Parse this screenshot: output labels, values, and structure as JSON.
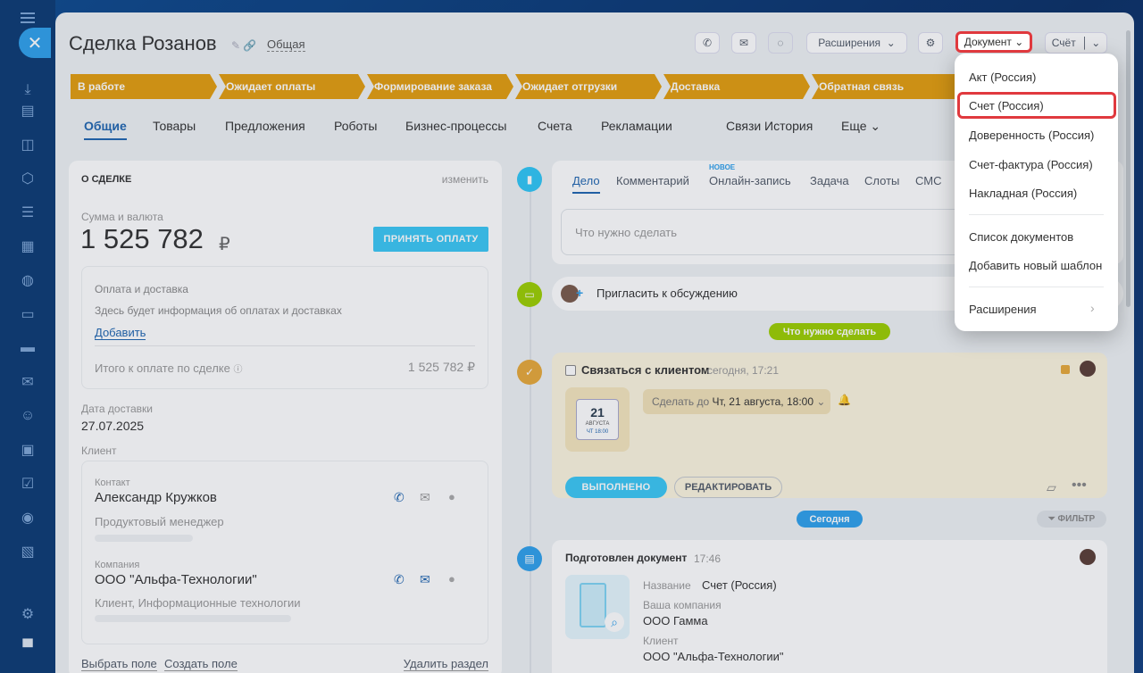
{
  "header": {
    "title": "Сделка Розанов",
    "category": "Общая",
    "extensions": "Расширения",
    "document": "Документ",
    "invoice": "Счёт"
  },
  "stages": [
    "В работе",
    "Ожидает оплаты",
    "Формирование заказа",
    "Ожидает отгрузки",
    "Доставка",
    "Обратная связь"
  ],
  "tabs": [
    "Общие",
    "Товары",
    "Предложения",
    "Роботы",
    "Бизнес-процессы",
    "Счета",
    "Рекламации",
    "Связи",
    "История",
    "Еще"
  ],
  "about": {
    "heading": "О СДЕЛКЕ",
    "edit": "изменить",
    "sum_label": "Сумма и валюта",
    "sum_value": "1 525 782",
    "currency": "₽",
    "pay_button": "ПРИНЯТЬ ОПЛАТУ",
    "payment_title": "Оплата и доставка",
    "payment_info": "Здесь будет информация об оплатах и доставках",
    "add": "Добавить",
    "total_label": "Итого к оплате по сделке",
    "total_value": "1 525 782 ₽",
    "delivery_label": "Дата доставки",
    "delivery_value": "27.07.2025",
    "client_label": "Клиент",
    "contact_label": "Контакт",
    "contact_name": "Александр Кружков",
    "contact_role": "Продуктовый менеджер",
    "company_label": "Компания",
    "company_name": "ООО \"Альфа-Технологии\"",
    "company_desc": "Клиент, Информационные технологии",
    "choose_field": "Выбрать поле",
    "create_field": "Создать поле",
    "delete_section": "Удалить раздел"
  },
  "activity": {
    "tabs": [
      "Дело",
      "Комментарий",
      "Онлайн-запись",
      "Задача",
      "Слоты",
      "СМС"
    ],
    "new_badge": "НОВОЕ",
    "placeholder": "Что нужно сделать",
    "invite": "Пригласить к обсуждению"
  },
  "timeline": {
    "todo_pill": "Что нужно сделать",
    "task_title": "Связаться с клиентом",
    "task_time": "сегодня, 17:21",
    "cal_day": "21",
    "cal_month": "АВГУСТА",
    "cal_time": "ЧТ 18:00",
    "deadline_prefix": "Сделать до",
    "deadline_value": "Чт, 21 августа, 18:00",
    "done": "ВЫПОЛНЕНО",
    "edit": "РЕДАКТИРОВАТЬ",
    "today_pill": "Сегодня",
    "filter": "ФИЛЬТР",
    "doc_title": "Подготовлен документ",
    "doc_time": "17:46",
    "name_label": "Название",
    "name_value": "Счет (Россия)",
    "company_label": "Ваша компания",
    "company_value": "ООО Гамма",
    "client_label": "Клиент",
    "client_value": "ООО \"Альфа-Технологии\""
  },
  "menu": {
    "items": [
      "Акт (Россия)",
      "Счет (Россия)",
      "Доверенность (Россия)",
      "Счет-фактура (Россия)",
      "Накладная (Россия)"
    ],
    "list": "Список документов",
    "add_template": "Добавить новый шаблон",
    "extensions": "Расширения"
  }
}
